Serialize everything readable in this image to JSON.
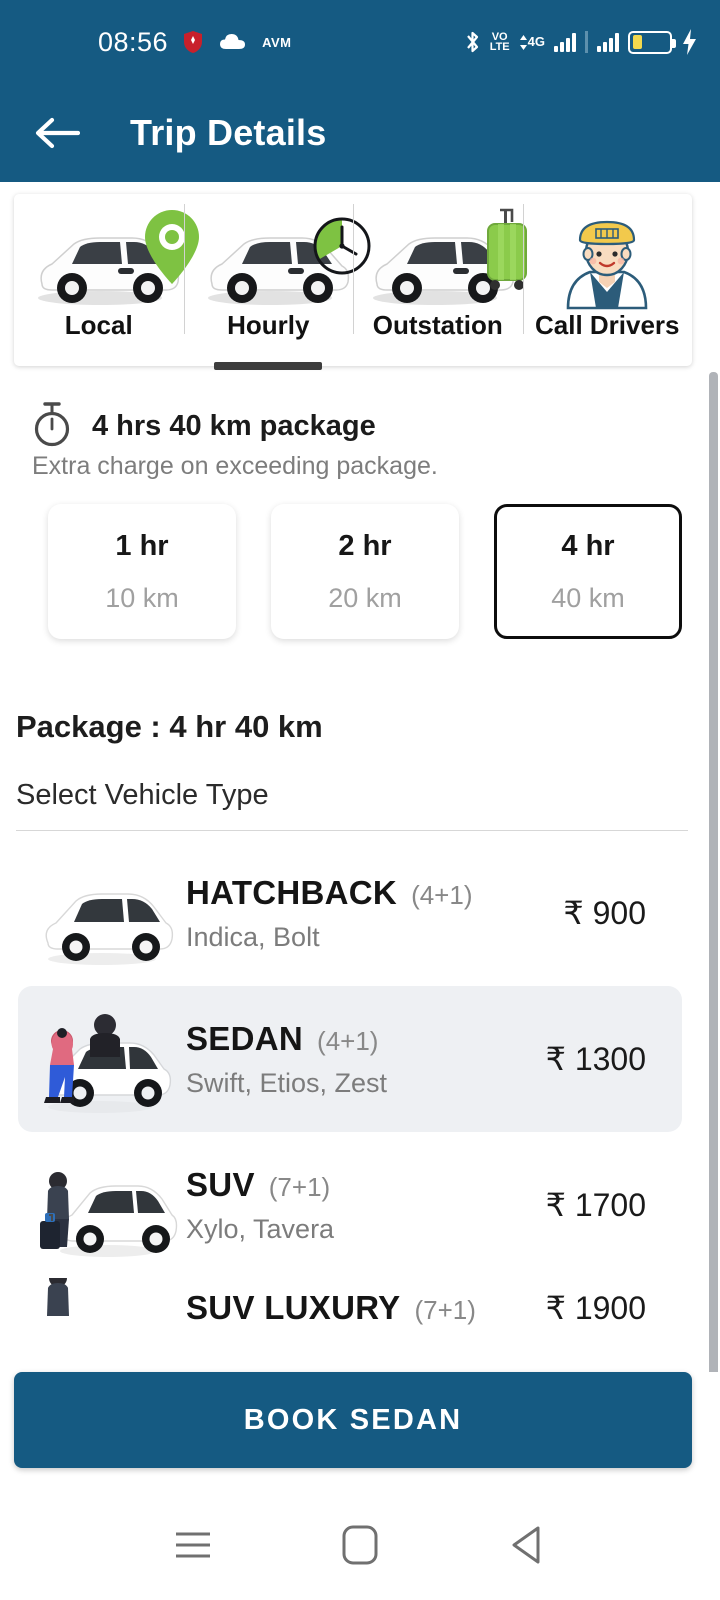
{
  "status_bar": {
    "time": "08:56",
    "carrier_label": "AVM",
    "icons": [
      "shield-icon",
      "cloud-icon",
      "bluetooth-icon",
      "volte-icon",
      "4g-icon",
      "signal-bars-icon",
      "battery-icon",
      "charging-bolt-icon"
    ],
    "volte_top": "VO",
    "volte_bottom": "LTE",
    "network": "4G",
    "battery_level_percent": 28
  },
  "app_bar": {
    "back_icon": "back-arrow-icon",
    "title": "Trip Details"
  },
  "tabs": {
    "active_index": 1,
    "items": [
      {
        "label": "Local",
        "icon": "car-with-location-pin-icon"
      },
      {
        "label": "Hourly",
        "icon": "car-with-clock-icon"
      },
      {
        "label": "Outstation",
        "icon": "car-with-luggage-icon"
      },
      {
        "label": "Call Drivers",
        "icon": "driver-avatar-icon"
      }
    ]
  },
  "package": {
    "icon": "stopwatch-icon",
    "title": "4 hrs 40 km package",
    "subtitle": "Extra charge on exceeding package.",
    "summary_label": "Package : 4 hr 40 km",
    "durations": [
      {
        "hours": "1 hr",
        "distance": "10 km",
        "selected": false
      },
      {
        "hours": "2 hr",
        "distance": "20 km",
        "selected": false
      },
      {
        "hours": "4 hr",
        "distance": "40 km",
        "selected": true
      }
    ]
  },
  "vehicle_section": {
    "heading": "Select Vehicle Type",
    "vehicles": [
      {
        "name": "HATCHBACK",
        "capacity": "(4+1)",
        "models": "Indica, Bolt",
        "price": "₹ 900",
        "selected": false,
        "icon": "hatchback-car-icon"
      },
      {
        "name": "SEDAN",
        "capacity": "(4+1)",
        "models": "Swift, Etios, Zest",
        "price": "₹ 1300",
        "selected": true,
        "icon": "sedan-car-with-passengers-icon"
      },
      {
        "name": "SUV",
        "capacity": "(7+1)",
        "models": "Xylo, Tavera",
        "price": "₹ 1700",
        "selected": false,
        "icon": "suv-car-with-traveler-icon"
      },
      {
        "name": "SUV LUXURY",
        "capacity": "(7+1)",
        "models": "",
        "price": "₹ 1900",
        "selected": false,
        "icon": "luxury-suv-icon"
      }
    ]
  },
  "book_button": {
    "label": "BOOK SEDAN"
  },
  "nav_bar": {
    "items": [
      {
        "icon": "recents-menu-icon"
      },
      {
        "icon": "home-square-icon"
      },
      {
        "icon": "back-triangle-icon"
      }
    ]
  },
  "colors": {
    "brand_blue": "#155A82",
    "selected_row_bg": "#eef0f3",
    "accent_green": "#7EC242",
    "battery_yellow": "#F2D94E"
  }
}
